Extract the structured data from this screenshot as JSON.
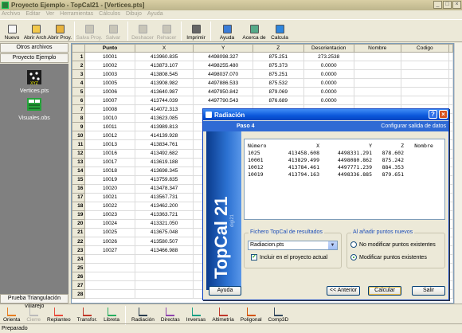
{
  "window": {
    "title": "Proyecto Ejemplo - TopCal21 - [Vertices.pts]"
  },
  "menu": [
    "Archivo",
    "Editar",
    "Ver",
    "Herramientas",
    "Cálculos",
    "Dibujo",
    "Ayuda"
  ],
  "toolbar": [
    {
      "label": "Nuevo",
      "icon": "new-file-icon",
      "enabled": true
    },
    {
      "label": "Abrir Arch.",
      "icon": "open-folder-icon",
      "enabled": true
    },
    {
      "label": "Abrir Proy.",
      "icon": "open-project-icon",
      "enabled": true
    },
    {
      "label": "Salva Proy.",
      "icon": "save-project-icon",
      "enabled": false
    },
    {
      "label": "Salvar",
      "icon": "save-icon",
      "enabled": false
    },
    {
      "label": "Deshacer",
      "icon": "undo-icon",
      "enabled": false
    },
    {
      "label": "Rehacer",
      "icon": "redo-icon",
      "enabled": false
    },
    {
      "label": "Imprimir",
      "icon": "printer-icon",
      "enabled": true
    },
    {
      "label": "Ayuda",
      "icon": "help-icon",
      "enabled": true
    },
    {
      "label": "Acerca de",
      "icon": "about-icon",
      "enabled": true
    },
    {
      "label": "Calcula",
      "icon": "calculator-icon",
      "enabled": true
    }
  ],
  "sidebar": {
    "header": "Otros archivos",
    "project": "Proyecto Ejemplo",
    "items": [
      {
        "label": "Vertices.pts",
        "icon": "points-file-icon"
      },
      {
        "label": "Visuales.obs",
        "icon": "observations-file-icon"
      }
    ],
    "footer": "Prueba Triangulación Villarejo"
  },
  "grid": {
    "columns": [
      "Punto",
      "X",
      "Y",
      "Z",
      "Desorientacion",
      "Nombre",
      "Codigo"
    ],
    "rows": [
      [
        "10001",
        "413960.835",
        "4498098.327",
        "875.251",
        "273.2538",
        "",
        ""
      ],
      [
        "10002",
        "413873.107",
        "4498255.480",
        "875.373",
        "0.0000",
        "",
        ""
      ],
      [
        "10003",
        "413808.545",
        "4498037.070",
        "875.251",
        "0.0000",
        "",
        ""
      ],
      [
        "10005",
        "413908.982",
        "4497886.533",
        "875.532",
        "0.0000",
        "",
        ""
      ],
      [
        "10006",
        "413640.987",
        "4497950.842",
        "879.069",
        "0.0000",
        "",
        ""
      ],
      [
        "10007",
        "413744.039",
        "4497790.543",
        "876.689",
        "0.0000",
        "",
        ""
      ],
      [
        "10008",
        "414072.313",
        "",
        "",
        "",
        "",
        ""
      ],
      [
        "10010",
        "413623.085",
        "",
        "",
        "",
        "",
        ""
      ],
      [
        "10011",
        "413989.813",
        "",
        "",
        "",
        "",
        ""
      ],
      [
        "10012",
        "414139.928",
        "",
        "",
        "",
        "",
        ""
      ],
      [
        "10013",
        "413834.761",
        "",
        "",
        "",
        "",
        ""
      ],
      [
        "10016",
        "413492.682",
        "",
        "",
        "",
        "",
        ""
      ],
      [
        "10017",
        "413619.188",
        "",
        "",
        "",
        "",
        ""
      ],
      [
        "10018",
        "413698.345",
        "",
        "",
        "",
        "",
        ""
      ],
      [
        "10019",
        "413759.835",
        "",
        "",
        "",
        "",
        ""
      ],
      [
        "10020",
        "413478.347",
        "",
        "",
        "",
        "",
        ""
      ],
      [
        "10021",
        "413567.731",
        "",
        "",
        "",
        "",
        ""
      ],
      [
        "10022",
        "413462.200",
        "",
        "",
        "",
        "",
        ""
      ],
      [
        "10023",
        "413363.721",
        "",
        "",
        "",
        "",
        ""
      ],
      [
        "10024",
        "413321.050",
        "",
        "",
        "",
        "",
        ""
      ],
      [
        "10025",
        "413675.048",
        "",
        "",
        "",
        "",
        ""
      ],
      [
        "10026",
        "413580.507",
        "",
        "",
        "",
        "",
        ""
      ],
      [
        "10027",
        "413466.988",
        "",
        "",
        "",
        "",
        ""
      ],
      [
        "",
        "",
        "",
        "",
        "",
        "",
        ""
      ],
      [
        "",
        "",
        "",
        "",
        "",
        "",
        ""
      ],
      [
        "",
        "",
        "",
        "",
        "",
        "",
        ""
      ],
      [
        "",
        "",
        "",
        "",
        "",
        "",
        ""
      ],
      [
        "",
        "",
        "",
        "",
        "",
        "",
        ""
      ]
    ]
  },
  "bottombar": [
    {
      "label": "Orienta",
      "icon": "orient-icon",
      "enabled": true
    },
    {
      "label": "Cierre",
      "icon": "closure-icon",
      "enabled": false
    },
    {
      "label": "Replanteo",
      "icon": "stakeout-icon",
      "enabled": true
    },
    {
      "label": "Transfor.",
      "icon": "transform-icon",
      "enabled": true
    },
    {
      "label": "Libreta",
      "icon": "notebook-icon",
      "enabled": true
    },
    {
      "label": "Radiación",
      "icon": "radiation-icon",
      "enabled": true
    },
    {
      "label": "Directas",
      "icon": "direct-icon",
      "enabled": true
    },
    {
      "label": "Inversas",
      "icon": "inverse-icon",
      "enabled": true
    },
    {
      "label": "Altimetría",
      "icon": "altimetry-icon",
      "enabled": true
    },
    {
      "label": "Poligonal",
      "icon": "traverse-icon",
      "enabled": true
    },
    {
      "label": "Comp3D",
      "icon": "comp3d-icon",
      "enabled": true
    }
  ],
  "status": "Preparado",
  "dialog": {
    "title": "Radiación",
    "step": "Paso 4",
    "step_desc": "Configurar salida de datos",
    "banner": "TopCal 21",
    "banner_sub": "digi21",
    "list_headers": [
      "Número",
      "X",
      "Y",
      "Z",
      "Nombre"
    ],
    "list_rows": [
      [
        "1025",
        "413458.608",
        "4498331.291",
        "878.602",
        ""
      ],
      [
        "10001",
        "413829.499",
        "4498080.862",
        "875.242",
        ""
      ],
      [
        "10012",
        "413784.461",
        "4497771.239",
        "884.353",
        ""
      ],
      [
        "10019",
        "413794.163",
        "4498336.885",
        "879.651",
        ""
      ]
    ],
    "file_group": "Fichero TopCal de resultados",
    "file_value": "Radiacion.pts",
    "include_label": "Incluir en el proyecto actual",
    "include_checked": true,
    "new_points_group": "Al añadir puntos nuevos",
    "radio_no_modify": "No modificar puntos existentes",
    "radio_modify": "Modificar puntos existentes",
    "selected_radio": "modify",
    "btn_help": "Ayuda",
    "btn_back": "<< Anterior",
    "btn_calc": "Calcular",
    "btn_exit": "Salir"
  },
  "colors": {
    "dialog_title": "#0a56da",
    "panel_grey": "#808080",
    "accent_green": "#21a121"
  }
}
